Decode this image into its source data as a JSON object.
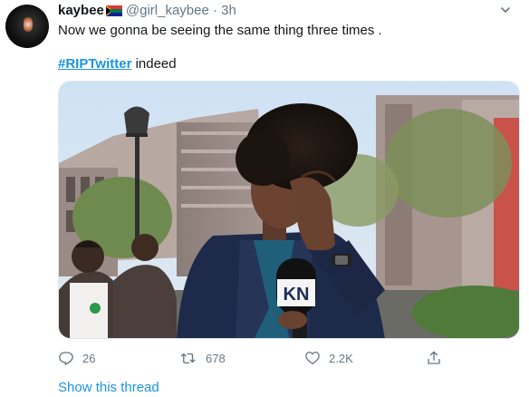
{
  "tweet": {
    "display_name": "kaybee",
    "handle": "@girl_kaybee",
    "separator": "·",
    "time": "3h",
    "text": "Now we gonna be seeing the same thing three times .",
    "hashtag": "#RIPTwitter",
    "text_after_hashtag": " indeed",
    "media": {
      "mic_label": "KN"
    },
    "actions": {
      "reply_count": "26",
      "retweet_count": "678",
      "like_count": "2.2K"
    },
    "show_thread": "Show this thread"
  },
  "icons": {
    "flag": "south-africa-flag-icon",
    "menu": "chevron-down-icon",
    "reply": "reply-icon",
    "retweet": "retweet-icon",
    "like": "heart-icon",
    "share": "share-icon"
  },
  "colors": {
    "link": "#1b95e0",
    "muted": "#657786",
    "text": "#14171a"
  }
}
